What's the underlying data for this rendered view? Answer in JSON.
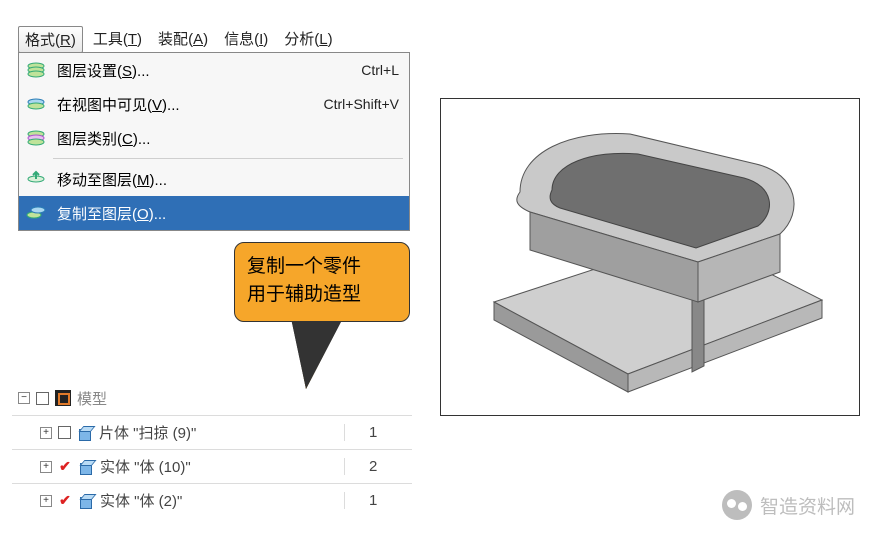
{
  "menubar": {
    "items": [
      {
        "label": "格式",
        "mn": "R",
        "active": true
      },
      {
        "label": "工具",
        "mn": "T"
      },
      {
        "label": "装配",
        "mn": "A"
      },
      {
        "label": "信息",
        "mn": "I"
      },
      {
        "label": "分析",
        "mn": "L"
      }
    ]
  },
  "dropdown": {
    "groups": [
      [
        {
          "label": "图层设置",
          "mn": "S",
          "ell": "...",
          "shortcut": "Ctrl+L",
          "icon": "layers-settings"
        },
        {
          "label": "在视图中可见",
          "mn": "V",
          "ell": "...",
          "shortcut": "Ctrl+Shift+V",
          "icon": "layers-visible"
        },
        {
          "label": "图层类别",
          "mn": "C",
          "ell": "...",
          "shortcut": "",
          "icon": "layers-category"
        }
      ],
      [
        {
          "label": "移动至图层",
          "mn": "M",
          "ell": "...",
          "shortcut": "",
          "icon": "move-to-layer"
        },
        {
          "label": "复制至图层",
          "mn": "O",
          "ell": "...",
          "shortcut": "",
          "icon": "copy-to-layer",
          "highlighted": true
        }
      ]
    ]
  },
  "callout": {
    "line1": "复制一个零件",
    "line2": "用于辅助造型"
  },
  "tree": {
    "root_label": "模型",
    "rows": [
      {
        "checked": false,
        "label": "片体 \"扫掠 (9)\"",
        "count": "1"
      },
      {
        "checked": true,
        "label": "实体 \"体 (10)\"",
        "count": "2"
      },
      {
        "checked": true,
        "label": "实体 \"体 (2)\"",
        "count": "1"
      }
    ]
  },
  "watermark": {
    "text": "智造资料网"
  }
}
